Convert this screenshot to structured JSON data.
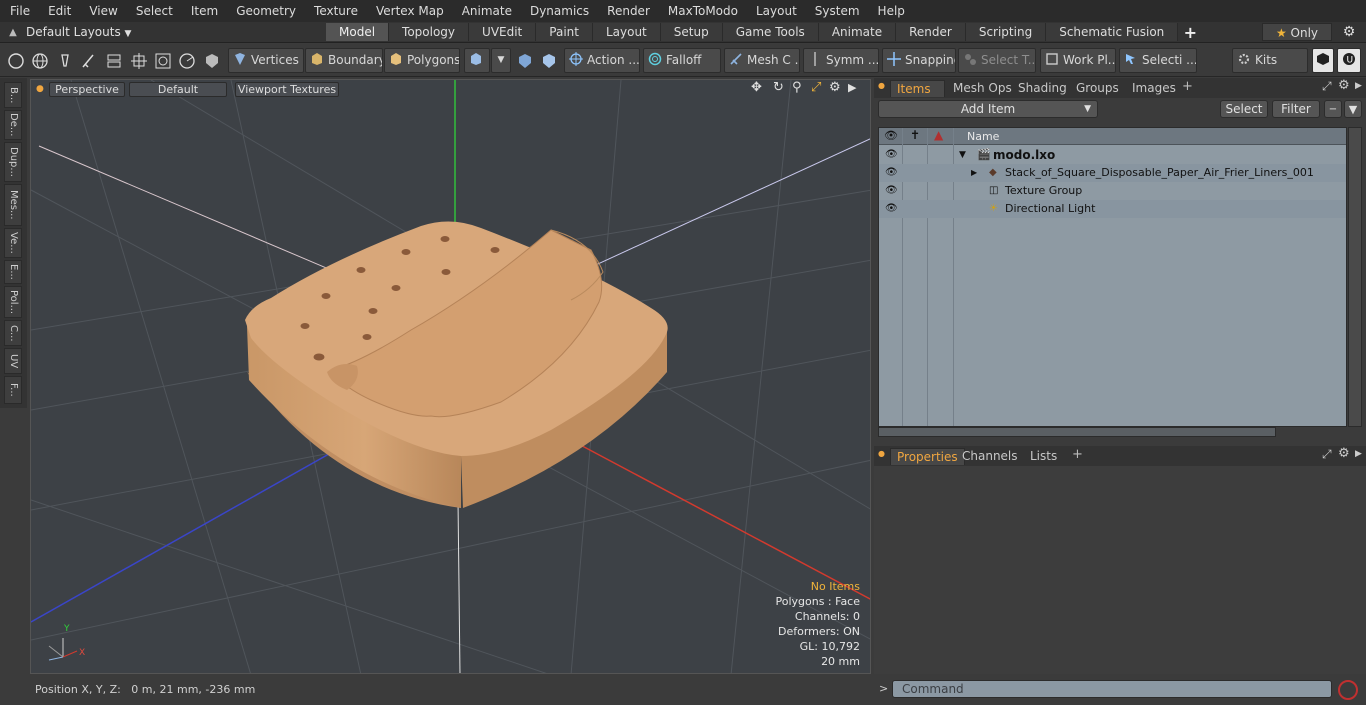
{
  "menu": [
    "File",
    "Edit",
    "View",
    "Select",
    "Item",
    "Geometry",
    "Texture",
    "Vertex Map",
    "Animate",
    "Dynamics",
    "Render",
    "MaxToModo",
    "Layout",
    "System",
    "Help"
  ],
  "layouts": {
    "dropdown": "Default Layouts",
    "tabs": [
      "Model",
      "Topology",
      "UVEdit",
      "Paint",
      "Layout",
      "Setup",
      "Game Tools",
      "Animate",
      "Render",
      "Scripting",
      "Schematic Fusion"
    ],
    "active": "Model",
    "only_label": "Only"
  },
  "toolbar": {
    "vertices": "Vertices",
    "boundary": "Boundary",
    "polygons": "Polygons",
    "action": "Action",
    "falloff": "Falloff",
    "mesh": "Mesh C ...",
    "symm": "Symm ...",
    "snapping": "Snapping",
    "select_t": "Select T...",
    "work_pl": "Work Pl...",
    "selecti": "Selecti ...",
    "kits": "Kits"
  },
  "left_tabs": [
    "B...",
    "De...",
    "Dup...",
    "Mes...",
    "Ve...",
    "E...",
    "Pol...",
    "C...",
    "UV",
    "F..."
  ],
  "viewport": {
    "perspective": "Perspective",
    "default": "Default",
    "textures": "Viewport Textures",
    "stats": {
      "no_items": "No Items",
      "polygons": "Polygons : Face",
      "channels": "Channels: 0",
      "deformers": "Deformers: ON",
      "gl": "GL: 10,792",
      "scale": "20 mm"
    },
    "axis_y": "Y",
    "axis_x": "X"
  },
  "status": "Position X, Y, Z:   0 m, 21 mm, -236 mm",
  "items_panel": {
    "tabs": [
      "Items",
      "Mesh Ops",
      "Shading",
      "Groups",
      "Images"
    ],
    "active": "Items",
    "add_item": "Add Item",
    "select": "Select",
    "filter": "Filter",
    "name_col": "Name",
    "rows": [
      {
        "name": "modo.lxo"
      },
      {
        "name": "Stack_of_Square_Disposable_Paper_Air_Frier_Liners_001"
      },
      {
        "name": "Texture Group"
      },
      {
        "name": "Directional Light"
      }
    ]
  },
  "props_panel": {
    "tabs": [
      "Properties",
      "Channels",
      "Lists"
    ],
    "active": "Properties"
  },
  "command": {
    "placeholder": "Command"
  },
  "colors": {
    "accent": "#f0a640",
    "list_bg": "#8e9aa3",
    "liner": "#d9a77a"
  }
}
